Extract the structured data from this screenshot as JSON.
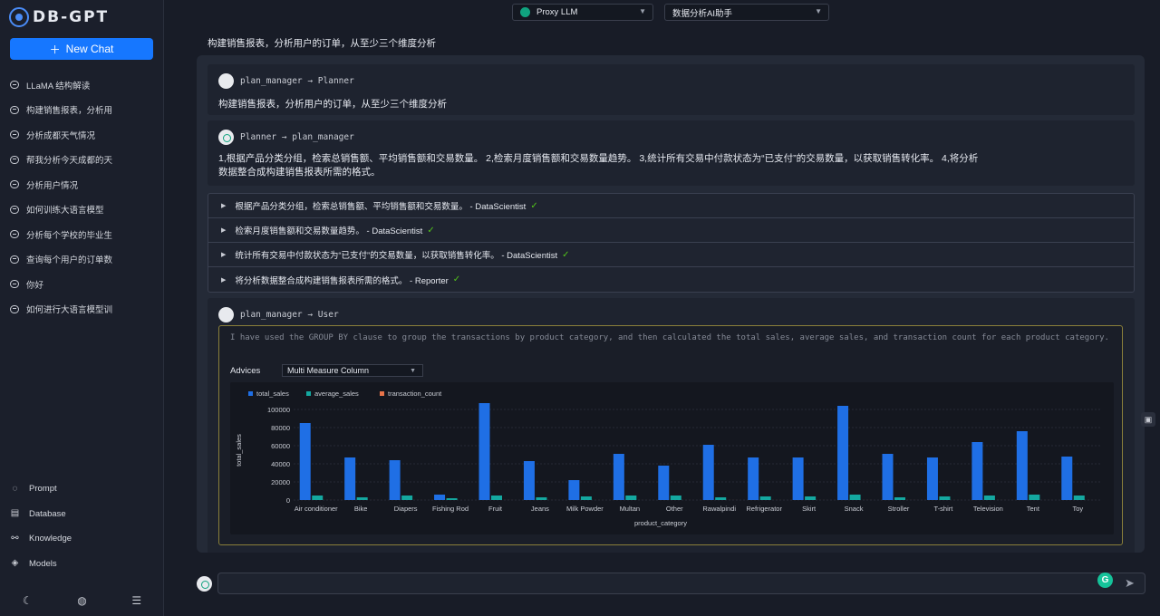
{
  "app": {
    "logo_text": "DB-GPT",
    "new_chat": "New Chat"
  },
  "history": [
    "LLaMA 结构解读",
    "构建销售报表，分析用",
    "分析成都天气情况",
    "帮我分析今天成都的天",
    "分析用户情况",
    "如何训练大语言模型",
    "分析每个学校的毕业生",
    "查询每个用户的订单数",
    "你好",
    "如何进行大语言模型训"
  ],
  "bottom_nav": [
    {
      "label": "Prompt",
      "icon": "chat-icon"
    },
    {
      "label": "Database",
      "icon": "database-icon"
    },
    {
      "label": "Knowledge",
      "icon": "knowledge-icon"
    },
    {
      "label": "Models",
      "icon": "models-icon"
    }
  ],
  "top": {
    "model": "Proxy LLM",
    "scene": "数据分析AI助手"
  },
  "question": "构建销售报表，分析用户的订单，从至少三个维度分析",
  "messages": {
    "m1_head": "plan_manager → Planner",
    "m1_body": "构建销售报表，分析用户的订单，从至少三个维度分析",
    "m2_head": "Planner → plan_manager",
    "m2_body_line1": "1,根据产品分类分组，检索总销售额、平均销售额和交易数量。 2,检索月度销售额和交易数量趋势。 3,统计所有交易中付款状态为“已支付”的交易数量，以获取销售转化率。 4,将分析",
    "m2_body_line2": "数据整合成构建销售报表所需的格式。",
    "m3_head": "plan_manager → User"
  },
  "steps": [
    "根据产品分类分组，检索总销售额、平均销售额和交易数量。 - DataScientist",
    "检索月度销售额和交易数量趋势。 - DataScientist",
    "统计所有交易中付款状态为“已支付”的交易数量，以获取销售转化率。 - DataScientist",
    "将分析数据整合成构建销售报表所需的格式。 - Reporter"
  ],
  "result": {
    "text": "I have used the GROUP BY clause to group the transactions by product category, and then calculated the total sales, average sales, and transaction count for each product category.",
    "advices_label": "Advices",
    "advices_value": "Multi Measure Column"
  },
  "input": {
    "placeholder": ""
  },
  "colors": {
    "accent": "#1677ff",
    "total_sales": "#1f6fe5",
    "average_sales": "#14a8a0",
    "transaction_count": "#e8744a"
  },
  "chart_data": {
    "type": "bar",
    "categories": [
      "Air conditioner",
      "Bike",
      "Diapers",
      "Fishing Rod",
      "Fruit",
      "Jeans",
      "Milk Powder",
      "Multan",
      "Other",
      "Rawalpindi",
      "Refrigerator",
      "Skirt",
      "Snack",
      "Stroller",
      "T-shirt",
      "Television",
      "Tent",
      "Toy"
    ],
    "series": [
      {
        "name": "total_sales",
        "values": [
          85000,
          47000,
          44000,
          6000,
          107000,
          43000,
          22000,
          51000,
          38000,
          61000,
          47000,
          47000,
          104000,
          51000,
          47000,
          64000,
          76000,
          48000
        ]
      },
      {
        "name": "average_sales",
        "values": [
          5000,
          3000,
          5000,
          2000,
          5000,
          3000,
          4000,
          5000,
          5000,
          3000,
          4000,
          4000,
          6000,
          3000,
          4000,
          5000,
          6000,
          5000
        ]
      },
      {
        "name": "transaction_count",
        "values": [
          20,
          15,
          10,
          3,
          21,
          14,
          5,
          10,
          8,
          20,
          12,
          12,
          17,
          17,
          12,
          13,
          13,
          10
        ]
      }
    ],
    "y_ticks": [
      "0",
      "20000",
      "40000",
      "60000",
      "80000",
      "100000"
    ],
    "ylim": [
      0,
      110000
    ],
    "xlabel": "product_category",
    "ylabel": "total_sales",
    "legend_position": "top-left",
    "grid": true
  }
}
